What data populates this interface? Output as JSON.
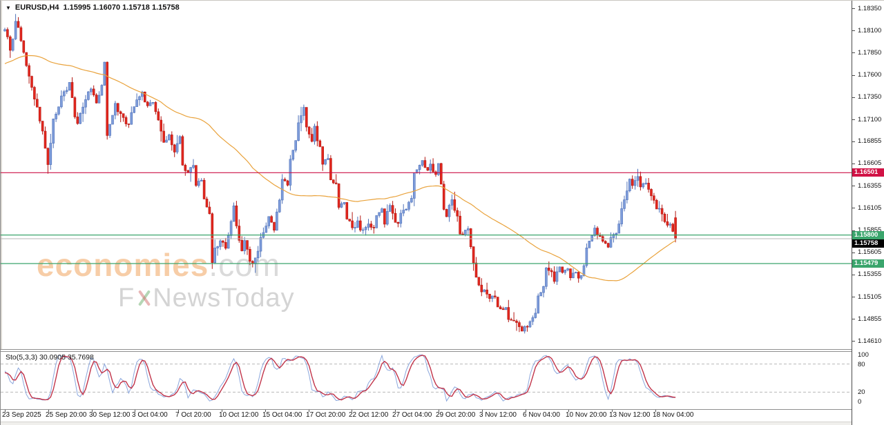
{
  "header": {
    "symbol": "EURUSD,H4",
    "ohlc_text": "1.15995 1.16070 1.15718 1.15758",
    "dropdown_glyph": "▼"
  },
  "watermark": {
    "brand": "economies",
    "brand_suffix": ".com",
    "tagline_prefix": "F",
    "tagline_rest": "NewsToday"
  },
  "colors": {
    "candle_up_fill": "#7e9cda",
    "candle_up_border": "#4f72ba",
    "candle_down_fill": "#e3271e",
    "candle_down_border": "#b31712",
    "ma_line": "#e9a23b",
    "resistance_line": "#cc1144",
    "support_line": "#3aa56c",
    "current_price_line": "#b5b5b5",
    "stoch_main": "#8aa6dc",
    "stoch_signal": "#c13349",
    "stoch_level_dash": "#b8b8b8"
  },
  "chart_data": {
    "type": "candlestick",
    "symbol": "EURUSD",
    "timeframe": "H4",
    "last_candle": {
      "open": 1.15995,
      "high": 1.1607,
      "low": 1.15718,
      "close": 1.15758
    },
    "ylim": [
      1.1461,
      1.1835
    ],
    "y_ticks": [
      "1.18350",
      "1.18100",
      "1.17850",
      "1.17600",
      "1.17350",
      "1.17100",
      "1.16855",
      "1.16605",
      "1.16355",
      "1.16105",
      "1.15855",
      "1.15605",
      "1.15355",
      "1.15105",
      "1.14855",
      "1.14610"
    ],
    "time_labels": [
      "23 Sep 2025",
      "25 Sep 20:00",
      "30 Sep 12:00",
      "3 Oct 04:00",
      "7 Oct 20:00",
      "10 Oct 12:00",
      "15 Oct 04:00",
      "17 Oct 20:00",
      "22 Oct 12:00",
      "27 Oct 04:00",
      "29 Oct 20:00",
      "3 Nov 12:00",
      "6 Nov 04:00",
      "10 Nov 20:00",
      "13 Nov 12:00",
      "18 Nov 04:00"
    ],
    "candle_count": 250,
    "levels": [
      {
        "price": 1.16501,
        "label": "1.16501",
        "type": "resistance",
        "color": "#cc1144",
        "badge_bg": "#d11245",
        "badge_fg": "#ffffff"
      },
      {
        "price": 1.158,
        "label": "1.15800",
        "type": "support",
        "color": "#3aa56c",
        "badge_bg": "#3aa56c",
        "badge_fg": "#ffffff"
      },
      {
        "price": 1.15479,
        "label": "1.15479",
        "type": "support",
        "color": "#3aa56c",
        "badge_bg": "#3aa56c",
        "badge_fg": "#ffffff"
      }
    ],
    "current_price": {
      "price": 1.15758,
      "label": "1.15758",
      "line_color": "#b5b5b5",
      "badge_bg": "#000000",
      "badge_fg": "#ffffff"
    },
    "price_path": [
      [
        0,
        1.1814
      ],
      [
        2,
        1.1786
      ],
      [
        4,
        1.182
      ],
      [
        6,
        1.1801
      ],
      [
        8,
        1.177
      ],
      [
        11,
        1.1735
      ],
      [
        14,
        1.1696
      ],
      [
        16,
        1.1661
      ],
      [
        18,
        1.1708
      ],
      [
        21,
        1.1735
      ],
      [
        24,
        1.175
      ],
      [
        26,
        1.1714
      ],
      [
        27,
        1.1705
      ],
      [
        30,
        1.1735
      ],
      [
        32,
        1.1744
      ],
      [
        34,
        1.1728
      ],
      [
        36,
        1.1748
      ],
      [
        37,
        1.1774
      ],
      [
        38,
        1.1691
      ],
      [
        41,
        1.1726
      ],
      [
        43,
        1.1714
      ],
      [
        46,
        1.1703
      ],
      [
        48,
        1.1727
      ],
      [
        51,
        1.1738
      ],
      [
        53,
        1.1727
      ],
      [
        55,
        1.1731
      ],
      [
        57,
        1.1707
      ],
      [
        59,
        1.1684
      ],
      [
        61,
        1.1692
      ],
      [
        63,
        1.1676
      ],
      [
        65,
        1.1688
      ],
      [
        66,
        1.1661
      ],
      [
        68,
        1.1649
      ],
      [
        70,
        1.1661
      ],
      [
        71,
        1.1634
      ],
      [
        73,
        1.1642
      ],
      [
        74,
        1.1618
      ],
      [
        76,
        1.1603
      ],
      [
        77,
        1.1549
      ],
      [
        78,
        1.1564
      ],
      [
        80,
        1.1576
      ],
      [
        82,
        1.1568
      ],
      [
        83,
        1.158
      ],
      [
        85,
        1.1611
      ],
      [
        86,
        1.1588
      ],
      [
        88,
        1.156
      ],
      [
        89,
        1.1572
      ],
      [
        91,
        1.1552
      ],
      [
        92,
        1.1545
      ],
      [
        94,
        1.156
      ],
      [
        95,
        1.1576
      ],
      [
        97,
        1.1588
      ],
      [
        98,
        1.1603
      ],
      [
        100,
        1.1588
      ],
      [
        102,
        1.1618
      ],
      [
        103,
        1.1645
      ],
      [
        105,
        1.1634
      ],
      [
        106,
        1.1665
      ],
      [
        108,
        1.1684
      ],
      [
        109,
        1.1704
      ],
      [
        111,
        1.1723
      ],
      [
        112,
        1.17
      ],
      [
        114,
        1.1688
      ],
      [
        115,
        1.17
      ],
      [
        117,
        1.1677
      ],
      [
        118,
        1.1661
      ],
      [
        120,
        1.1669
      ],
      [
        121,
        1.1645
      ],
      [
        123,
        1.1638
      ],
      [
        124,
        1.1611
      ],
      [
        126,
        1.1618
      ],
      [
        127,
        1.1599
      ],
      [
        129,
        1.1587
      ],
      [
        131,
        1.1595
      ],
      [
        132,
        1.1583
      ],
      [
        134,
        1.1591
      ],
      [
        135,
        1.1595
      ],
      [
        137,
        1.1587
      ],
      [
        138,
        1.1599
      ],
      [
        140,
        1.1607
      ],
      [
        141,
        1.1595
      ],
      [
        143,
        1.1614
      ],
      [
        144,
        1.1603
      ],
      [
        146,
        1.1591
      ],
      [
        147,
        1.1603
      ],
      [
        149,
        1.1611
      ],
      [
        151,
        1.1622
      ],
      [
        152,
        1.1649
      ],
      [
        154,
        1.1657
      ],
      [
        155,
        1.1661
      ],
      [
        157,
        1.1653
      ],
      [
        158,
        1.1657
      ],
      [
        160,
        1.1649
      ],
      [
        161,
        1.1661
      ],
      [
        163,
        1.1611
      ],
      [
        164,
        1.1603
      ],
      [
        166,
        1.1618
      ],
      [
        168,
        1.16
      ],
      [
        169,
        1.1583
      ],
      [
        170,
        1.158
      ],
      [
        172,
        1.1588
      ],
      [
        173,
        1.1568
      ],
      [
        175,
        1.1533
      ],
      [
        177,
        1.1518
      ],
      [
        178,
        1.1521
      ],
      [
        180,
        1.151
      ],
      [
        181,
        1.1514
      ],
      [
        183,
        1.1502
      ],
      [
        184,
        1.1494
      ],
      [
        186,
        1.1498
      ],
      [
        187,
        1.1486
      ],
      [
        189,
        1.1482
      ],
      [
        190,
        1.1479
      ],
      [
        192,
        1.1471
      ],
      [
        194,
        1.1479
      ],
      [
        195,
        1.1482
      ],
      [
        197,
        1.1494
      ],
      [
        198,
        1.1514
      ],
      [
        200,
        1.1521
      ],
      [
        201,
        1.1541
      ],
      [
        203,
        1.1537
      ],
      [
        204,
        1.1529
      ],
      [
        206,
        1.1545
      ],
      [
        207,
        1.1537
      ],
      [
        209,
        1.1541
      ],
      [
        210,
        1.1533
      ],
      [
        212,
        1.1541
      ],
      [
        213,
        1.1529
      ],
      [
        215,
        1.1545
      ],
      [
        216,
        1.1564
      ],
      [
        218,
        1.158
      ],
      [
        219,
        1.1587
      ],
      [
        221,
        1.1576
      ],
      [
        222,
        1.1572
      ],
      [
        224,
        1.1564
      ],
      [
        225,
        1.1576
      ],
      [
        227,
        1.1583
      ],
      [
        228,
        1.1595
      ],
      [
        230,
        1.1622
      ],
      [
        232,
        1.1641
      ],
      [
        233,
        1.1638
      ],
      [
        235,
        1.1643
      ],
      [
        236,
        1.1634
      ],
      [
        238,
        1.164
      ],
      [
        239,
        1.163
      ],
      [
        241,
        1.1618
      ],
      [
        242,
        1.1611
      ],
      [
        244,
        1.1603
      ],
      [
        245,
        1.1595
      ],
      [
        247,
        1.1591
      ],
      [
        248,
        1.1583
      ],
      [
        250,
        1.15758
      ]
    ],
    "warmup_path_offscreen": [
      [
        -55,
        1.1728
      ],
      [
        -45,
        1.1748
      ],
      [
        -35,
        1.1762
      ],
      [
        -25,
        1.1776
      ],
      [
        -15,
        1.1792
      ],
      [
        -7,
        1.1802
      ],
      [
        -1,
        1.1808
      ]
    ],
    "indicators": {
      "ma": {
        "type": "SMA",
        "period": 55,
        "color": "#e9a23b"
      },
      "stochastic": {
        "label": "Sto(5,3,3) 30.0905 35.7698",
        "k_period": 5,
        "d_period": 3,
        "slowing": 3,
        "last_main": 30.0905,
        "last_signal": 35.7698,
        "levels": [
          20,
          80
        ],
        "scale_ticks": [
          {
            "label": "100",
            "value": 100
          },
          {
            "label": "80",
            "value": 80
          },
          {
            "label": "20",
            "value": 20
          },
          {
            "label": "0",
            "value": 0
          }
        ],
        "main_color": "#8aa6dc",
        "signal_color": "#c13349"
      }
    }
  }
}
